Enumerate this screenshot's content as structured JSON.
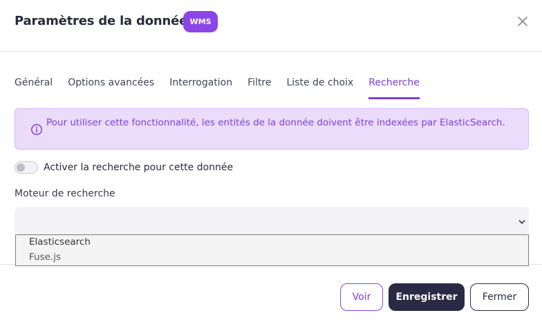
{
  "dialog": {
    "title": "Paramètres de la donnée",
    "badge": "WMS",
    "close_icon": "close-icon"
  },
  "tabs": [
    {
      "label": "Général"
    },
    {
      "label": "Options avancées"
    },
    {
      "label": "Interrogation"
    },
    {
      "label": "Filtre"
    },
    {
      "label": "Liste de choix"
    },
    {
      "label": "Recherche",
      "active": true
    }
  ],
  "alert": {
    "icon": "info-icon",
    "text": "Pour utiliser cette fonctionnalité, les entités de la donnée doivent être indexées par ElasticSearch."
  },
  "toggle": {
    "label": "Activer la recherche pour cette donnée",
    "checked": false
  },
  "engine": {
    "label": "Moteur de recherche",
    "value": "",
    "options": [
      "Elasticsearch",
      "Fuse.js"
    ]
  },
  "footer": {
    "view_label": "Voir",
    "save_label": "Enregistrer",
    "close_label": "Fermer"
  },
  "colors": {
    "accent": "#7b3fd6",
    "badge": "#8b45e6",
    "primary_button": "#2a2a45",
    "alert_bg": "#ecdcfb"
  }
}
